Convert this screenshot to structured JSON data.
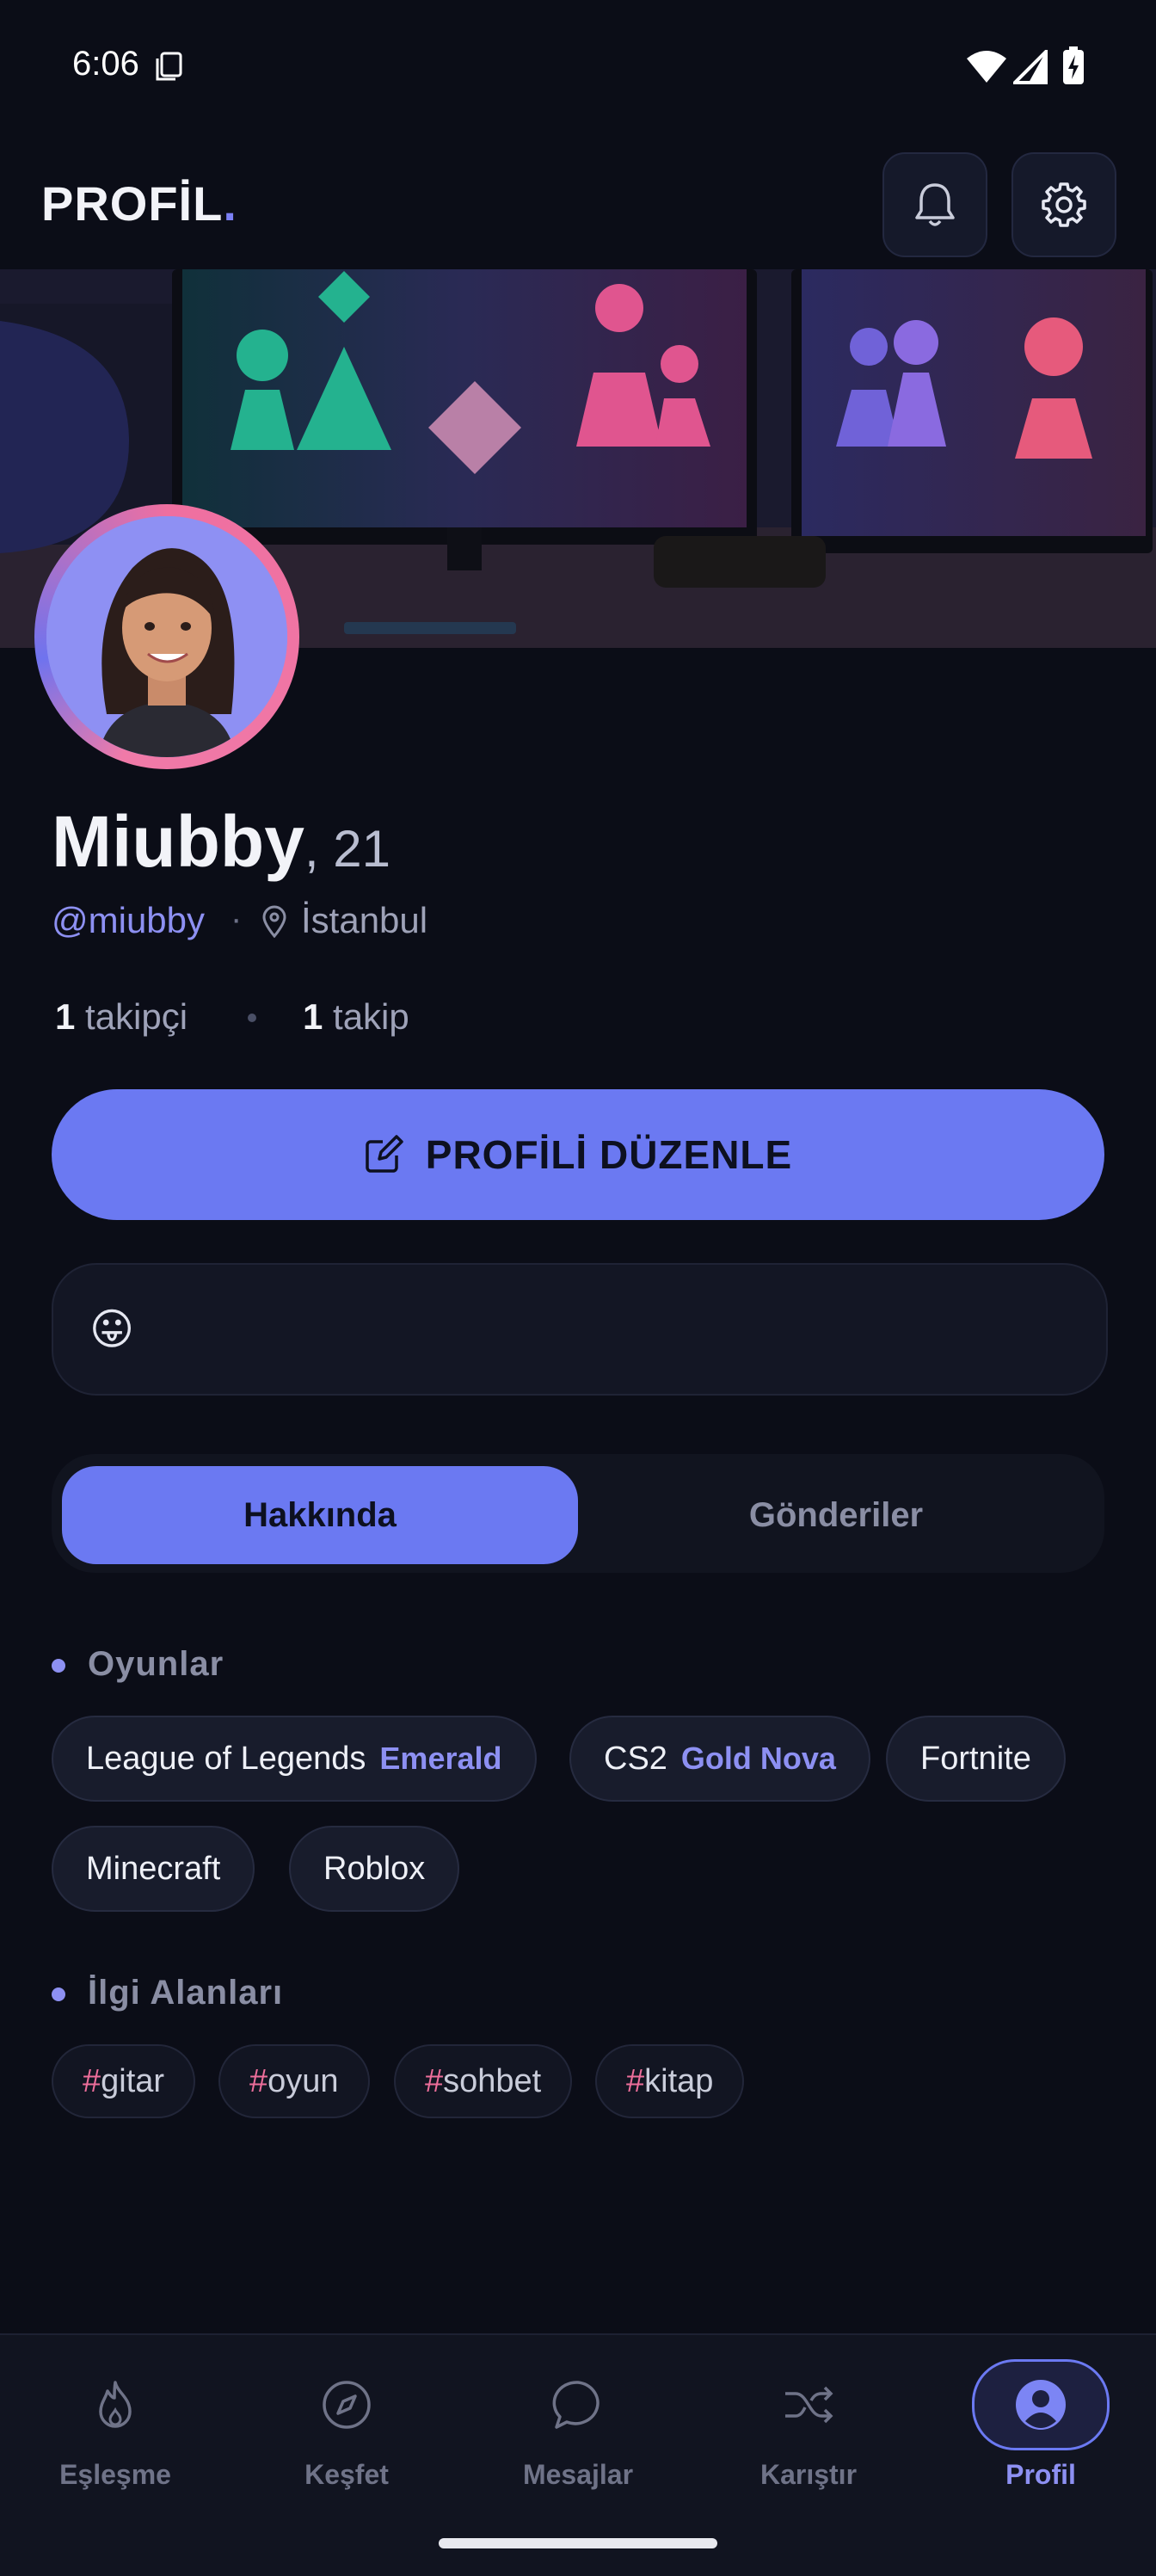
{
  "status_bar": {
    "time": "6:06"
  },
  "header": {
    "title": "PROFİL",
    "title_dot": "."
  },
  "profile": {
    "name": "Miubby",
    "age": ", 21",
    "handle": "@miubby",
    "separator": "·",
    "location": "İstanbul",
    "followers_count": "1",
    "followers_label": "takipçi",
    "following_count": "1",
    "following_label": "takip",
    "status_emoji": "😛"
  },
  "actions": {
    "edit_label": "PROFİLİ DÜZENLE"
  },
  "tabs": [
    {
      "label": "Hakkında",
      "active": true
    },
    {
      "label": "Gönderiler",
      "active": false
    }
  ],
  "games_section": {
    "title": "Oyunlar",
    "games": [
      {
        "name": "League of Legends",
        "rank": "Emerald"
      },
      {
        "name": "CS2",
        "rank": "Gold Nova"
      },
      {
        "name": "Fortnite",
        "rank": ""
      },
      {
        "name": "Minecraft",
        "rank": ""
      },
      {
        "name": "Roblox",
        "rank": ""
      }
    ]
  },
  "interests_section": {
    "title": "İlgi Alanları",
    "hash": "#",
    "tags": [
      "gitar",
      "oyun",
      "sohbet",
      "kitap"
    ]
  },
  "bottom_nav": [
    {
      "label": "Eşleşme",
      "icon": "flame-icon"
    },
    {
      "label": "Keşfet",
      "icon": "compass-icon"
    },
    {
      "label": "Mesajlar",
      "icon": "chat-bubble-icon"
    },
    {
      "label": "Karıştır",
      "icon": "shuffle-icon"
    },
    {
      "label": "Profil",
      "icon": "user-icon",
      "active": true
    }
  ],
  "colors": {
    "accent": "#6b79f2",
    "pink": "#ee6e9b",
    "background": "#0b0d17"
  }
}
